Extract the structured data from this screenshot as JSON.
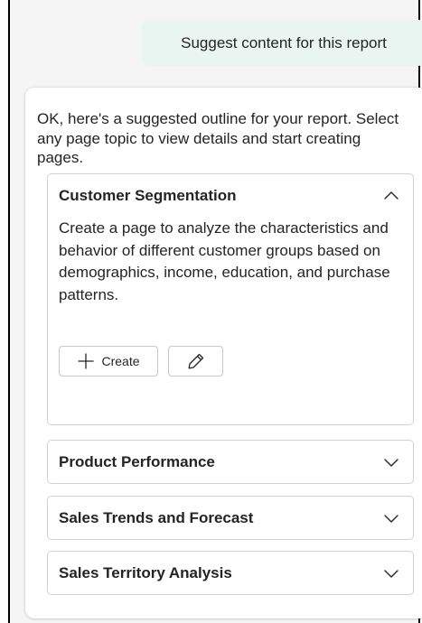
{
  "chat": {
    "user_message": "Suggest content for this report",
    "reply_intro": "OK, here's a suggested outline for your report. Select any page topic to view details and start creating pages.",
    "topics": [
      {
        "title": "Customer Segmentation",
        "expanded": true,
        "description": "Create a page to analyze the characteristics and behavior of different customer groups based on demographics, income, education, and purchase patterns.",
        "create_label": "Create",
        "create_icon": "plus-icon",
        "edit_icon": "pencil-icon"
      },
      {
        "title": "Product Performance",
        "expanded": false
      },
      {
        "title": "Sales Trends and Forecast",
        "expanded": false
      },
      {
        "title": "Sales Territory Analysis",
        "expanded": false
      }
    ]
  },
  "colors": {
    "user_bubble_bg": "#e8f5f0",
    "panel_bg": "#f5f5f5",
    "card_bg": "#ffffff",
    "border": "#d1d1d1"
  }
}
